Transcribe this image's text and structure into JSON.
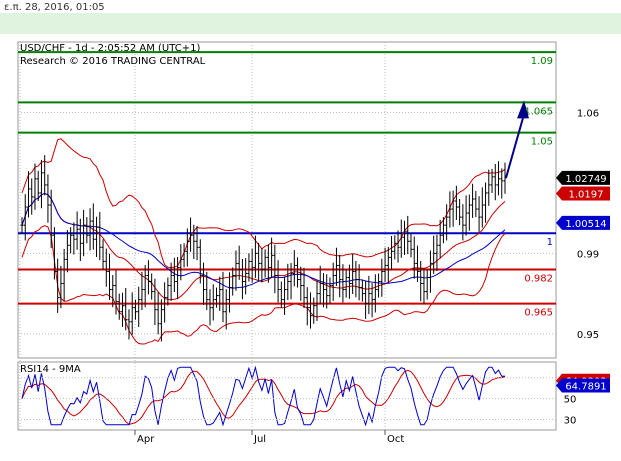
{
  "header": {
    "timestamp": "ε.π. 28, 2016, 01:05"
  },
  "chart_data": {
    "type": "candlestick",
    "title": "USD/CHF - 1d - 2:05:52 AM (UTC+1)",
    "subtitle": "Research © 2016 TRADING CENTRAL",
    "ylim": [
      0.938,
      1.095
    ],
    "y_ticks": [
      0.95,
      0.99,
      1.06
    ],
    "x_ticks": [
      "Apr",
      "Jul",
      "Oct"
    ],
    "price_series": [
      1.004,
      1.013,
      1.022,
      1.018,
      1.027,
      1.02,
      1.03,
      1.024,
      1.014,
      0.999,
      0.981,
      0.968,
      0.975,
      0.987,
      0.994,
      0.999,
      0.997,
      1.002,
      0.995,
      1.004,
      0.999,
      1.006,
      0.997,
      1.003,
      0.993,
      0.986,
      0.981,
      0.972,
      0.974,
      0.966,
      0.961,
      0.964,
      0.957,
      0.956,
      0.963,
      0.961,
      0.967,
      0.972,
      0.979,
      0.976,
      0.971,
      0.962,
      0.955,
      0.962,
      0.968,
      0.974,
      0.979,
      0.976,
      0.983,
      0.987,
      0.991,
      0.996,
      0.999,
      0.996,
      0.993,
      0.979,
      0.972,
      0.967,
      0.963,
      0.967,
      0.969,
      0.972,
      0.961,
      0.967,
      0.973,
      0.979,
      0.985,
      0.982,
      0.976,
      0.98,
      0.986,
      0.983,
      0.99,
      0.985,
      0.982,
      0.988,
      0.983,
      0.989,
      0.979,
      0.972,
      0.967,
      0.972,
      0.976,
      0.98,
      0.984,
      0.977,
      0.974,
      0.968,
      0.963,
      0.959,
      0.964,
      0.97,
      0.975,
      0.972,
      0.969,
      0.974,
      0.979,
      0.984,
      0.977,
      0.972,
      0.978,
      0.975,
      0.981,
      0.977,
      0.973,
      0.97,
      0.965,
      0.97,
      0.967,
      0.972,
      0.976,
      0.981,
      0.984,
      0.988,
      0.991,
      0.995,
      0.993,
      0.998,
      1.001,
      0.996,
      0.992,
      0.985,
      0.981,
      0.975,
      0.971,
      0.978,
      0.985,
      0.99,
      0.994,
      0.999,
      1.004,
      1.008,
      1.012,
      1.016,
      1.013,
      1.008,
      1.004,
      1.01,
      1.014,
      1.017,
      1.012,
      1.008,
      1.014,
      1.02,
      1.024,
      1.028,
      1.024,
      1.027,
      1.026,
      1.0275
    ],
    "levels": [
      {
        "value": 1.09,
        "label": "1.09",
        "color": "#008000"
      },
      {
        "value": 1.065,
        "label": "1.065",
        "color": "#008000"
      },
      {
        "value": 1.05,
        "label": "1.05",
        "color": "#008000"
      },
      {
        "value": 1.0,
        "label": "1",
        "color": "#0000cc"
      },
      {
        "value": 0.982,
        "label": "0.982",
        "color": "#cc0000"
      },
      {
        "value": 0.965,
        "label": "0.965",
        "color": "#cc0000"
      }
    ],
    "price_tags": [
      {
        "value": 1.02749,
        "label": "1.02749",
        "bg": "#000000",
        "fg": "#ffffff"
      },
      {
        "value": 1.0197,
        "label": "1.0197",
        "bg": "#cc0000",
        "fg": "#ffffff"
      },
      {
        "value": 1.00514,
        "label": "1.00514",
        "bg": "#0000cc",
        "fg": "#ffffff"
      }
    ],
    "projection": {
      "from": 1.0275,
      "to": 1.066
    },
    "rsi": {
      "title": "RSI14 - 9MA",
      "ylim": [
        20,
        85
      ],
      "y_ticks": [
        30,
        50,
        70
      ],
      "tags": [
        {
          "value": 64.9303,
          "label": "64.9303",
          "bg": "#cc0000",
          "fg": "#ffffff"
        },
        {
          "value": 64.7891,
          "label": "64.7891",
          "bg": "#0000cc",
          "fg": "#ffffff"
        }
      ]
    },
    "colors": {
      "bollinger": "#cc0000",
      "moving_average": "#0000cc",
      "candles": "#000000"
    }
  }
}
